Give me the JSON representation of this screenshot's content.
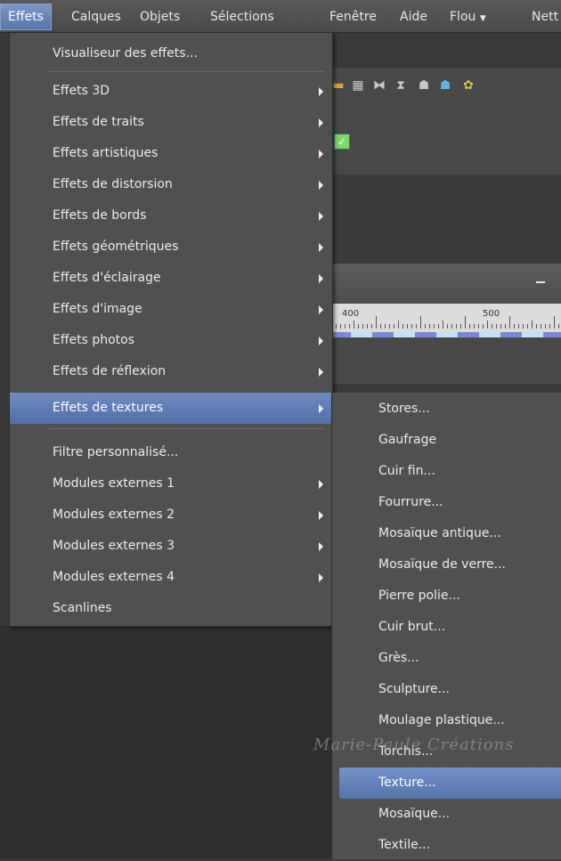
{
  "menubar": {
    "items": [
      "Effets",
      "Calques",
      "Objets",
      "Sélections",
      "Fenêtre",
      "Aide",
      "Flou",
      "Nett"
    ]
  },
  "menu": {
    "items": [
      {
        "label": "Visualiseur des effets...",
        "submenu": false
      },
      {
        "label": "Effets 3D",
        "submenu": true
      },
      {
        "label": "Effets de traits",
        "submenu": true
      },
      {
        "label": "Effets artistiques",
        "submenu": true
      },
      {
        "label": "Effets de distorsion",
        "submenu": true
      },
      {
        "label": "Effets de bords",
        "submenu": true
      },
      {
        "label": "Effets géométriques",
        "submenu": true
      },
      {
        "label": "Effets d'éclairage",
        "submenu": true
      },
      {
        "label": "Effets d'image",
        "submenu": true
      },
      {
        "label": "Effets photos",
        "submenu": true
      },
      {
        "label": "Effets de réflexion",
        "submenu": true
      },
      {
        "label": "Effets de textures",
        "submenu": true,
        "highlighted": true
      },
      {
        "label": "Filtre personnalisé...",
        "submenu": false
      },
      {
        "label": "Modules externes 1",
        "submenu": true
      },
      {
        "label": "Modules externes 2",
        "submenu": true
      },
      {
        "label": "Modules externes 3",
        "submenu": true
      },
      {
        "label": "Modules externes 4",
        "submenu": true
      },
      {
        "label": "Scanlines",
        "submenu": false
      }
    ]
  },
  "submenu": {
    "items": [
      "Stores...",
      "Gaufrage",
      "Cuir fin...",
      "Fourrure...",
      "Mosaïque antique...",
      "Mosaïque de verre...",
      "Pierre polie...",
      "Cuir brut...",
      "Grès...",
      "Sculpture...",
      "Moulage plastique...",
      "Torchis...",
      "Texture...",
      "Mosaïque...",
      "Textile..."
    ],
    "highlighted_index": 12
  },
  "ruler": {
    "labels": [
      "400",
      "500"
    ]
  },
  "watermark": "Marie-Paule Créations",
  "colors": {
    "highlight": "#5a78ae",
    "menu_bg": "#505050"
  }
}
